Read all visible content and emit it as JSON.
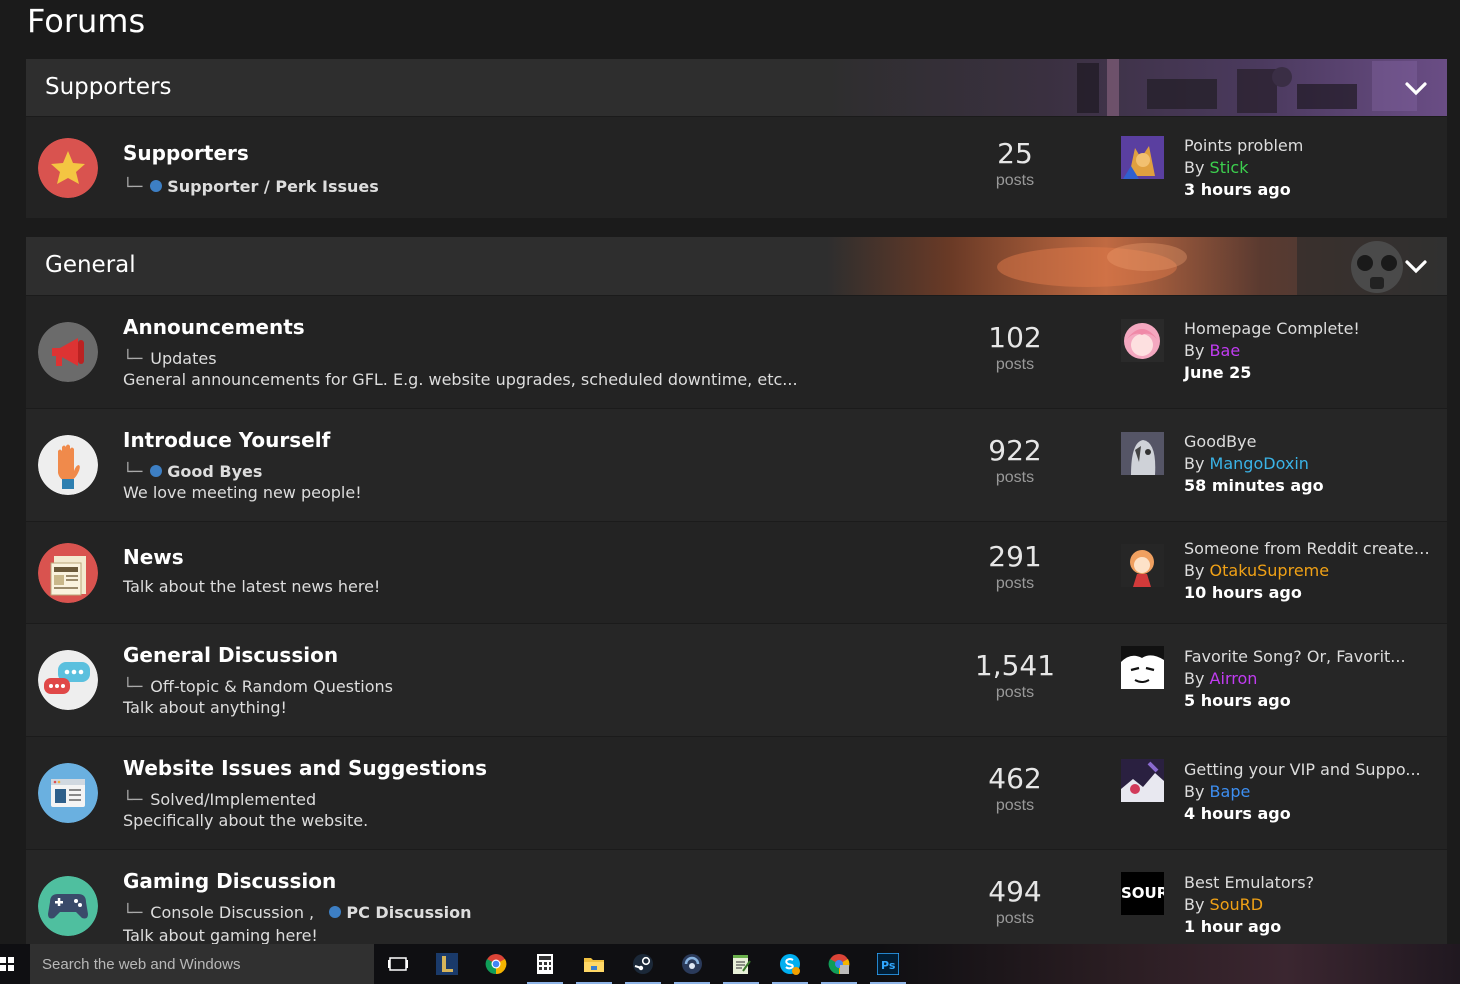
{
  "page": {
    "title": "Forums"
  },
  "categories": [
    {
      "title": "Supporters",
      "forums": [
        {
          "title": "Supporters",
          "sub": "Supporter / Perk Issues",
          "desc": "",
          "count": "25",
          "count_label": "posts",
          "last": {
            "topic": "Points problem",
            "by": "By",
            "user": "Stick",
            "user_color": "#3ccf4e",
            "ago": "3 hours ago"
          }
        }
      ]
    },
    {
      "title": "General",
      "forums": [
        {
          "title": "Announcements",
          "sub": "Updates",
          "desc": "General announcements for GFL. E.g. website upgrades, scheduled downtime, etc...",
          "count": "102",
          "count_label": "posts",
          "last": {
            "topic": "Homepage Complete!",
            "by": "By",
            "user": "Bae",
            "user_color": "#c13cf2",
            "ago": "June 25"
          }
        },
        {
          "title": "Introduce Yourself",
          "sub": "Good Byes",
          "desc": "We love meeting new people!",
          "count": "922",
          "count_label": "posts",
          "last": {
            "topic": "GoodBye",
            "by": "By",
            "user": "MangoDoxin",
            "user_color": "#3ab3e6",
            "ago": "58 minutes ago"
          }
        },
        {
          "title": "News",
          "sub": "",
          "desc": "Talk about the latest news here!",
          "count": "291",
          "count_label": "posts",
          "last": {
            "topic": "Someone from Reddit created...",
            "by": "By",
            "user": "OtakuSupreme",
            "user_color": "#f0a116",
            "ago": "10 hours ago"
          }
        },
        {
          "title": "General Discussion",
          "sub": "Off-topic & Random Questions",
          "desc": "Talk about anything!",
          "count": "1,541",
          "count_label": "posts",
          "last": {
            "topic": "Favorite Song? Or, Favorit...",
            "by": "By",
            "user": "Airron",
            "user_color": "#c13cf2",
            "ago": "5 hours ago"
          }
        },
        {
          "title": "Website Issues and Suggestions",
          "sub": "Solved/Implemented",
          "desc": "Specifically about the website.",
          "count": "462",
          "count_label": "posts",
          "last": {
            "topic": "Getting your VIP and Suppo...",
            "by": "By",
            "user": "Bape",
            "user_color": "#3d8ef0",
            "ago": "4 hours ago"
          }
        },
        {
          "title": "Gaming Discussion",
          "sub": "Console Discussion ,",
          "sub2": "PC Discussion",
          "desc": "Talk about gaming here!",
          "count": "494",
          "count_label": "posts",
          "last": {
            "topic": "Best Emulators?",
            "by": "By",
            "user": "SouRD",
            "user_color": "#f0a116",
            "ago": "1 hour ago",
            "avatar_text": "SOUR"
          }
        }
      ]
    }
  ],
  "taskbar": {
    "search_placeholder": "Search the web and Windows"
  }
}
